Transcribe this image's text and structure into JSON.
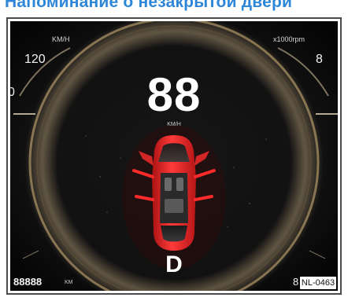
{
  "heading": "Напоминание о незакрытой двери",
  "cluster": {
    "speed_unit_top": "KM/H",
    "speed_max_label": "120",
    "rpm_unit": "x1000rpm",
    "rpm_max_label": "8",
    "speed_value": "88",
    "speed_value_unit": "KM/H",
    "gear": "D",
    "odometer": "88888",
    "odometer_unit": "KM",
    "left_edge_digit": "0",
    "right_edge_digit": "8",
    "image_code": "NL-0463",
    "door_warning_color": "#e02020",
    "car_color": "#e12828",
    "background_color": "#101010"
  },
  "icons": {
    "car": "open-door-car-icon"
  }
}
